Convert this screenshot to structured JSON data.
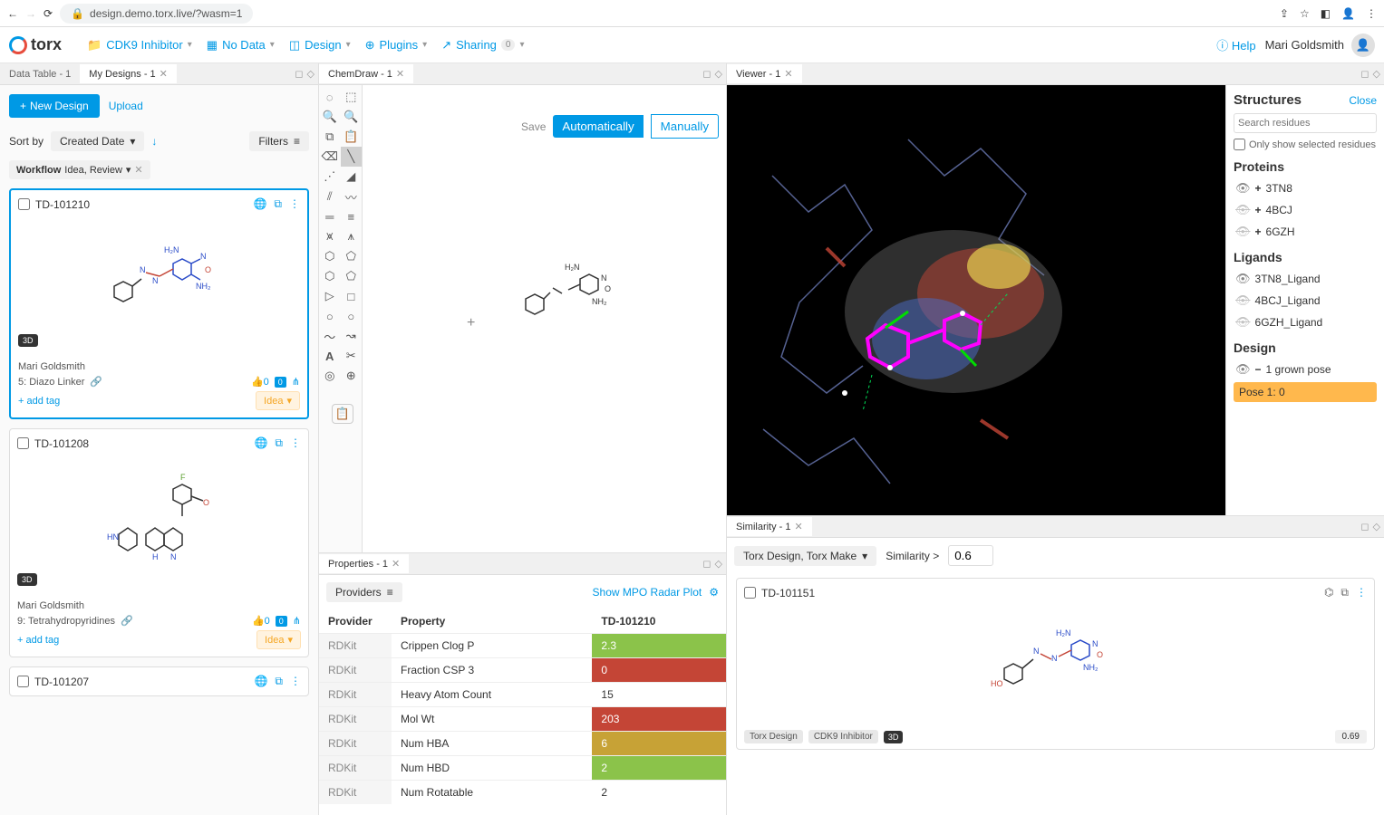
{
  "browser": {
    "url": "design.demo.torx.live/?wasm=1"
  },
  "logo": "torx",
  "toolbar": {
    "project": "CDK9 Inhibitor",
    "data": "No Data",
    "design": "Design",
    "plugins": "Plugins",
    "sharing": "Sharing",
    "sharing_count": "0",
    "help": "Help",
    "user": "Mari Goldsmith"
  },
  "tabs": {
    "left": [
      {
        "label": "Data Table - 1"
      },
      {
        "label": "My Designs - 1",
        "active": true
      }
    ],
    "mid": {
      "label": "ChemDraw - 1"
    },
    "props": {
      "label": "Properties - 1"
    },
    "viewer": {
      "label": "Viewer - 1"
    },
    "similarity": {
      "label": "Similarity - 1"
    }
  },
  "designs": {
    "new_btn": "New Design",
    "upload": "Upload",
    "sortby_label": "Sort by",
    "sortby_value": "Created Date",
    "filters": "Filters",
    "workflow_chip_label": "Workflow",
    "workflow_chip_value": "Idea, Review",
    "cards": [
      {
        "id": "TD-101210",
        "author": "Mari Goldsmith",
        "tag": "5: Diazo Linker",
        "addtag": "+ add tag",
        "status": "Idea",
        "badge3d": "3D",
        "selected": true
      },
      {
        "id": "TD-101208",
        "author": "Mari Goldsmith",
        "tag": "9: Tetrahydropyridines",
        "addtag": "+ add tag",
        "status": "Idea",
        "badge3d": "3D"
      },
      {
        "id": "TD-101207"
      }
    ]
  },
  "chemdraw": {
    "save": "Save",
    "auto": "Automatically",
    "manual": "Manually"
  },
  "properties": {
    "providers": "Providers",
    "show_mpo": "Show MPO Radar Plot",
    "headers": {
      "provider": "Provider",
      "property": "Property",
      "compound": "TD-101210"
    },
    "rows": [
      {
        "provider": "RDKit",
        "prop": "Crippen Clog P",
        "val": "2.3",
        "color": "green"
      },
      {
        "provider": "RDKit",
        "prop": "Fraction CSP 3",
        "val": "0",
        "color": "red"
      },
      {
        "provider": "RDKit",
        "prop": "Heavy Atom Count",
        "val": "15",
        "color": ""
      },
      {
        "provider": "RDKit",
        "prop": "Mol Wt",
        "val": "203",
        "color": "red"
      },
      {
        "provider": "RDKit",
        "prop": "Num HBA",
        "val": "6",
        "color": "yellow"
      },
      {
        "provider": "RDKit",
        "prop": "Num HBD",
        "val": "2",
        "color": "green"
      },
      {
        "provider": "RDKit",
        "prop": "Num Rotatable",
        "val": "2",
        "color": ""
      }
    ]
  },
  "viewer": {
    "structures_title": "Structures",
    "close": "Close",
    "search_placeholder": "Search residues",
    "only_selected": "Only show selected residues",
    "proteins_title": "Proteins",
    "proteins": [
      {
        "name": "3TN8",
        "vis": true
      },
      {
        "name": "4BCJ",
        "vis": false
      },
      {
        "name": "6GZH",
        "vis": false
      }
    ],
    "ligands_title": "Ligands",
    "ligands": [
      {
        "name": "3TN8_Ligand",
        "vis": true
      },
      {
        "name": "4BCJ_Ligand",
        "vis": false
      },
      {
        "name": "6GZH_Ligand",
        "vis": false
      }
    ],
    "design_title": "Design",
    "grown_pose": "1 grown pose",
    "pose": "Pose 1: 0"
  },
  "similarity": {
    "source": "Torx Design, Torx Make",
    "threshold_label": "Similarity >",
    "threshold": "0.6",
    "result": {
      "id": "TD-101151",
      "tags": [
        "Torx Design",
        "CDK9 Inhibitor"
      ],
      "badge3d": "3D",
      "score": "0.69"
    }
  }
}
